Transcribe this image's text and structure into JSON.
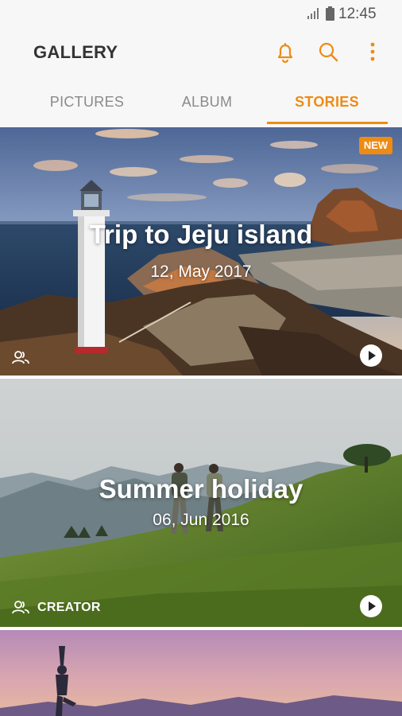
{
  "status_bar": {
    "time": "12:45",
    "icons": [
      "signal-icon",
      "battery-icon"
    ]
  },
  "header": {
    "title": "GALLERY",
    "actions": [
      "bell-icon",
      "search-icon",
      "more-vert-icon"
    ]
  },
  "tabs": [
    {
      "label": "PICTURES",
      "selected": false
    },
    {
      "label": "ALBUM",
      "selected": false
    },
    {
      "label": "STORIES",
      "selected": true
    }
  ],
  "stories": [
    {
      "title": "Trip to Jeju island",
      "date": "12, May 2017",
      "badge": "NEW",
      "shared": true,
      "creator_label": ""
    },
    {
      "title": "Summer holiday",
      "date": "06, Jun 2016",
      "badge": "",
      "shared": true,
      "creator_label": "CREATOR"
    },
    {
      "title": "",
      "date": "",
      "badge": "",
      "shared": false,
      "creator_label": ""
    }
  ],
  "colors": {
    "accent": "#ee8b14",
    "header_bg": "#f7f7f7",
    "tab_inactive": "#8a8a8a",
    "title_text": "#333333"
  }
}
